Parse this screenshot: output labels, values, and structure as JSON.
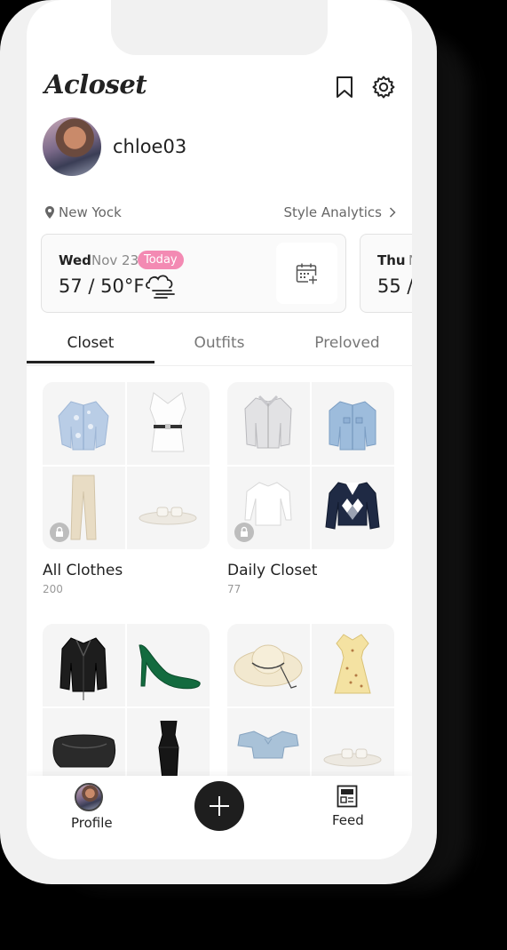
{
  "app": {
    "title": "Acloset"
  },
  "profile": {
    "username": "chloe03"
  },
  "location": {
    "city": "New Yock",
    "analytics_label": "Style Analytics"
  },
  "weather": [
    {
      "day": "Wed",
      "date": "Nov 23",
      "badge": "Today",
      "temp": "57 / 50°F",
      "icon": "cloud-wind-icon"
    },
    {
      "day": "Thu",
      "date": "N",
      "temp": "55 /"
    }
  ],
  "tabs": [
    {
      "label": "Closet",
      "active": true
    },
    {
      "label": "Outfits",
      "active": false
    },
    {
      "label": "Preloved",
      "active": false
    }
  ],
  "closets": [
    {
      "name": "All Clothes",
      "count": "200",
      "locked": true,
      "items": [
        "blue-cardigan",
        "white-blouse",
        "beige-pants",
        "white-sandals"
      ]
    },
    {
      "name": "Daily Closet",
      "count": "77",
      "locked": true,
      "items": [
        "grey-jacket",
        "denim-jacket",
        "white-top",
        "argyle-sweater"
      ]
    },
    {
      "name": "",
      "count": "",
      "locked": false,
      "items": [
        "black-leather-jacket",
        "green-heels",
        "black-clutch",
        "black-dress"
      ]
    },
    {
      "name": "",
      "count": "",
      "locked": false,
      "items": [
        "straw-hat",
        "yellow-dress",
        "blue-crop-top",
        "white-sandals"
      ]
    }
  ],
  "bottom_nav": {
    "profile_label": "Profile",
    "feed_label": "Feed"
  },
  "colors": {
    "accent_pink": "#f38ab3",
    "text_dark": "#1e1e1e",
    "muted": "#888888"
  }
}
